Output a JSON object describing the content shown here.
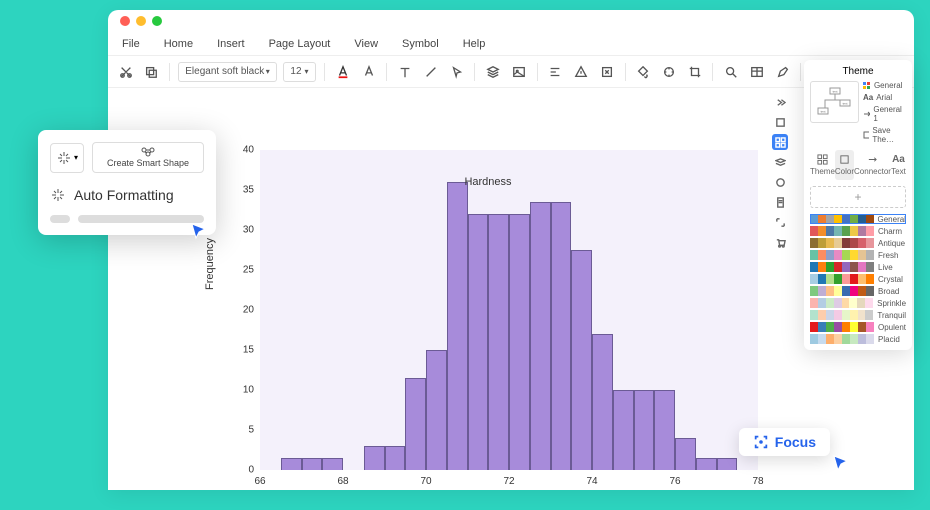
{
  "menu": {
    "file": "File",
    "home": "Home",
    "insert": "Insert",
    "page_layout": "Page Layout",
    "view": "View",
    "symbol": "Symbol",
    "help": "Help"
  },
  "toolbar": {
    "font": "Elegant soft black",
    "size": "12"
  },
  "popup": {
    "create_smart_shape": "Create Smart Shape",
    "auto_formatting": "Auto Formatting"
  },
  "theme": {
    "title": "Theme",
    "meta": {
      "general": "General",
      "font": "Arial",
      "general1": "General 1",
      "save": "Save The…"
    },
    "tabs": {
      "theme": "Theme",
      "color": "Color",
      "connector": "Connector",
      "text": "Text"
    },
    "add": "+",
    "rows": [
      "General",
      "Charm",
      "Antique",
      "Fresh",
      "Live",
      "Crystal",
      "Broad",
      "Sprinkle",
      "Tranquil",
      "Opulent",
      "Placid"
    ]
  },
  "focus": {
    "label": "Focus"
  },
  "chart_data": {
    "type": "bar",
    "title": "",
    "xlabel": "Hardness",
    "ylabel": "Frequency",
    "xlim": [
      66,
      78
    ],
    "ylim": [
      0,
      40
    ],
    "bin_width": 0.5,
    "bins": [
      66.5,
      67,
      67.5,
      68,
      68.5,
      69,
      69.5,
      70,
      70.5,
      71,
      71.5,
      72,
      72.5,
      73,
      73.5,
      74,
      74.5,
      75,
      75.5,
      76,
      76.5,
      77
    ],
    "values": [
      1.5,
      1.5,
      1.5,
      0,
      3,
      3,
      11.5,
      15,
      36,
      32,
      32,
      32,
      33.5,
      33.5,
      27.5,
      17,
      10,
      10,
      10,
      4,
      1.5,
      1.5
    ],
    "x_ticks": [
      66,
      68,
      70,
      72,
      74,
      76,
      78
    ],
    "y_ticks": [
      0,
      5,
      10,
      15,
      20,
      25,
      30,
      35,
      40
    ]
  },
  "color_palettes": [
    [
      "#5b9bd5",
      "#ed7d31",
      "#a5a5a5",
      "#ffc000",
      "#4472c4",
      "#70ad47",
      "#255e91",
      "#9e480e"
    ],
    [
      "#e15759",
      "#f28e2b",
      "#4e79a7",
      "#76b7b2",
      "#59a14f",
      "#edc948",
      "#b07aa1",
      "#ff9da7"
    ],
    [
      "#8c6d31",
      "#bd9e39",
      "#e7ba52",
      "#e7cb94",
      "#843c39",
      "#ad494a",
      "#d6616b",
      "#e7969c"
    ],
    [
      "#66c2a5",
      "#fc8d62",
      "#8da0cb",
      "#e78ac3",
      "#a6d854",
      "#ffd92f",
      "#e5c494",
      "#b3b3b3"
    ],
    [
      "#1f77b4",
      "#ff7f0e",
      "#2ca02c",
      "#d62728",
      "#9467bd",
      "#8c564b",
      "#e377c2",
      "#7f7f7f"
    ],
    [
      "#a6cee3",
      "#1f78b4",
      "#b2df8a",
      "#33a02c",
      "#fb9a99",
      "#e31a1c",
      "#fdbf6f",
      "#ff7f00"
    ],
    [
      "#7fc97f",
      "#beaed4",
      "#fdc086",
      "#ffff99",
      "#386cb0",
      "#f0027f",
      "#bf5b17",
      "#666666"
    ],
    [
      "#fbb4ae",
      "#b3cde3",
      "#ccebc5",
      "#decbe4",
      "#fed9a6",
      "#ffffcc",
      "#e5d8bd",
      "#fddaec"
    ],
    [
      "#b3e2cd",
      "#fdcdac",
      "#cbd5e8",
      "#f4cae4",
      "#e6f5c9",
      "#fff2ae",
      "#f1e2cc",
      "#cccccc"
    ],
    [
      "#e41a1c",
      "#377eb8",
      "#4daf4a",
      "#984ea3",
      "#ff7f00",
      "#ffff33",
      "#a65628",
      "#f781bf"
    ],
    [
      "#9ecae1",
      "#c6dbef",
      "#fdae6b",
      "#fdd0a2",
      "#a1d99b",
      "#c7e9c0",
      "#bcbddc",
      "#dadaeb"
    ]
  ]
}
